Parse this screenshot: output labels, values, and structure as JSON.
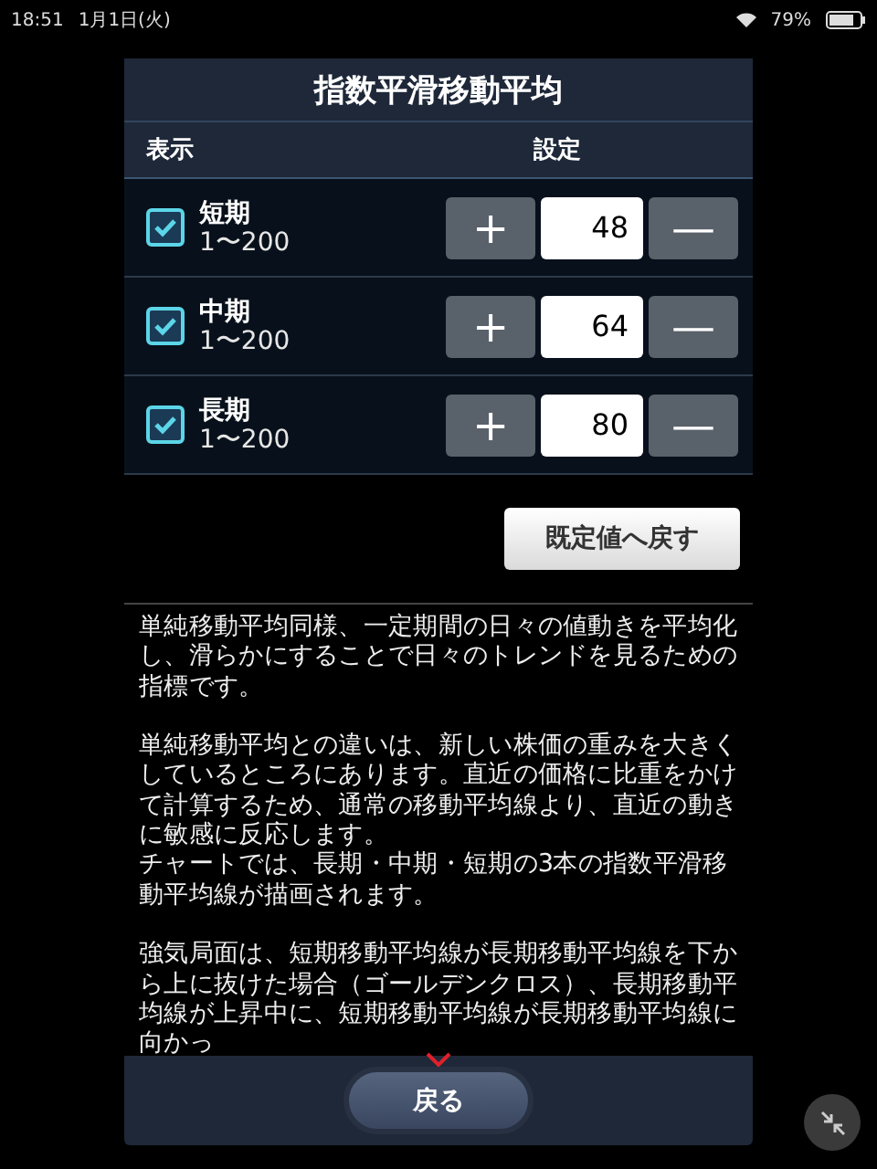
{
  "status_bar": {
    "time": "18:51",
    "date": "1月1日(火)",
    "battery": "79%"
  },
  "dialog": {
    "title": "指数平滑移動平均",
    "columns": [
      "表示",
      "設定"
    ],
    "rows": [
      {
        "name": "短期",
        "range": "1〜200",
        "checked": true,
        "value": "48",
        "plus": "+",
        "minus": "—"
      },
      {
        "name": "中期",
        "range": "1〜200",
        "checked": true,
        "value": "64",
        "plus": "+",
        "minus": "—"
      },
      {
        "name": "長期",
        "range": "1〜200",
        "checked": true,
        "value": "80",
        "plus": "+",
        "minus": "—"
      }
    ],
    "reset_button": "既定値へ戻す",
    "description": [
      {
        "lines": [
          "単純移動平均同様、一定期間の日々の値動きを平均化し、滑らかにすることで日々のトレンドを見るための指標です。"
        ]
      },
      {
        "lines": [
          "単純移動平均との違いは、新しい株価の重みを大きくしているところにあります。直近の価格に比重をかけて計算するため、通常の移動平均線より、直近の動きに敏感に反応します。",
          "チャートでは、長期・中期・短期の3本の指数平滑移動平均線が描画されます。"
        ]
      },
      {
        "lines": [
          "強気局面は、短期移動平均線が長期移動平均線を下から上に抜けた場合（ゴールデンクロス）、長期移動平均線が上昇中に、短期移動平均線が長期移動平均線に向かっ"
        ]
      }
    ],
    "back_button": "戻る"
  }
}
